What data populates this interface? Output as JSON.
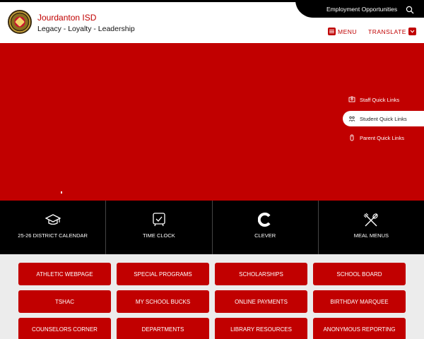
{
  "header": {
    "district_name": "Jourdanton ISD",
    "motto": "Legacy - Loyalty - Leadership",
    "employment_link": "Employment Opportunities",
    "menu_label": "MENU",
    "translate_label": "TRANSLATE"
  },
  "quick_links": [
    {
      "label": "Staff Quick Links",
      "icon": "staff-icon",
      "active": false
    },
    {
      "label": "Student Quick Links",
      "icon": "student-icon",
      "active": true
    },
    {
      "label": "Parent Quick Links",
      "icon": "parent-icon",
      "active": false
    }
  ],
  "tiles": [
    {
      "label": "25-26 DISTRICT CALENDAR",
      "icon": "graduation-cap-icon"
    },
    {
      "label": "TIME CLOCK",
      "icon": "clock-icon"
    },
    {
      "label": "CLEVER",
      "icon": "clever-icon"
    },
    {
      "label": "MEAL MENUS",
      "icon": "utensils-icon"
    }
  ],
  "buttons": [
    [
      "ATHLETIC WEBPAGE",
      "SPECIAL PROGRAMS",
      "SCHOLARSHIPS",
      "SCHOOL BOARD"
    ],
    [
      "TSHAC",
      "MY SCHOOL BUCKS",
      "ONLINE PAYMENTS",
      "BIRTHDAY MARQUEE"
    ],
    [
      "COUNSELORS CORNER",
      "DEPARTMENTS",
      "LIBRARY RESOURCES",
      "ANONYMOUS REPORTING"
    ]
  ],
  "colors": {
    "brand_red": "#c10000",
    "black": "#000000",
    "background": "#ececec"
  }
}
